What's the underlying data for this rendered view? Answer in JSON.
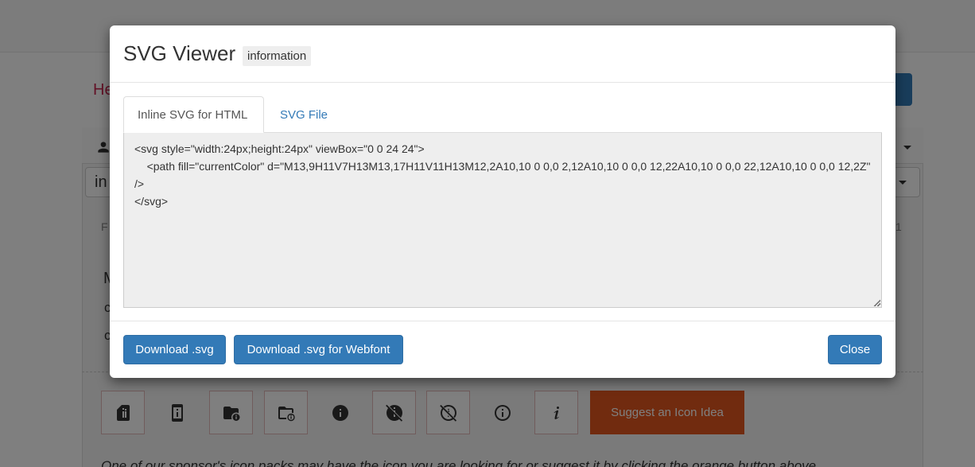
{
  "background": {
    "heading_fragment": "He",
    "select_fragment": "in",
    "left_fragments": [
      "F",
      "M",
      "c",
      "c"
    ],
    "right_fragment": "1",
    "suggest_button_label": "Suggest an Icon Idea",
    "bottom_text": "One of our sponsor's icon packs may have the icon you are looking for or suggest it by clicking the orange button above.",
    "icon_tiles": [
      {
        "icon": "sd-card-information-icon"
      },
      {
        "icon": "cellphone-information-icon"
      },
      {
        "icon": "folder-information-icon"
      },
      {
        "icon": "folder-information-outline-icon"
      },
      {
        "icon": "information-icon"
      },
      {
        "icon": "information-off-icon"
      },
      {
        "icon": "information-off-outline-icon"
      },
      {
        "icon": "information-outline-icon"
      },
      {
        "icon": "information-variant-icon"
      }
    ]
  },
  "modal": {
    "title": "SVG Viewer",
    "badge": "information",
    "tabs": [
      {
        "label": "Inline SVG for HTML",
        "active": true
      },
      {
        "label": "SVG File",
        "active": false
      }
    ],
    "code": "<svg style=\"width:24px;height:24px\" viewBox=\"0 0 24 24\">\n    <path fill=\"currentColor\" d=\"M13,9H11V7H13M13,17H11V11H13M12,2A10,10 0 0,0 2,12A10,10 0 0,0 12,22A10,10 0 0,0 22,12A10,10 0 0,0 12,2Z\" />\n</svg>",
    "buttons": {
      "download_svg": "Download .svg",
      "download_webfont": "Download .svg for Webfont",
      "close": "Close"
    }
  },
  "colors": {
    "primary": "#337ab7",
    "suggest": "#e2571e",
    "heading_accent": "#c7254e",
    "backdrop": "rgba(0,0,0,0.5)"
  }
}
